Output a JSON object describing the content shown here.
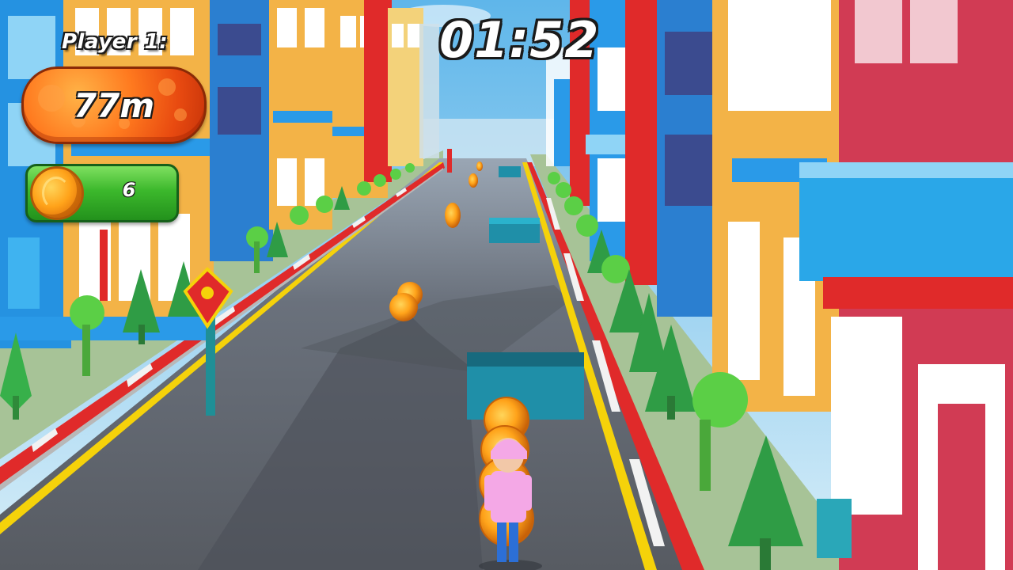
{
  "hud": {
    "player_label": "Player 1:",
    "distance": "77m",
    "coins": "6",
    "timer": "01:52"
  },
  "colors": {
    "sky": "#8fd0f2",
    "road": "#5b5f66",
    "curb_red": "#e02a2a",
    "curb_white": "#f2f2f2",
    "lane_yellow": "#f5d20a",
    "sidewalk": "#9bbf8a",
    "distance_panel": "#ff7a1f",
    "coin_panel": "#3cb82c",
    "coin": "#ffa31a"
  },
  "icons": {
    "coin": "coin-icon",
    "runner": "runner-character"
  }
}
